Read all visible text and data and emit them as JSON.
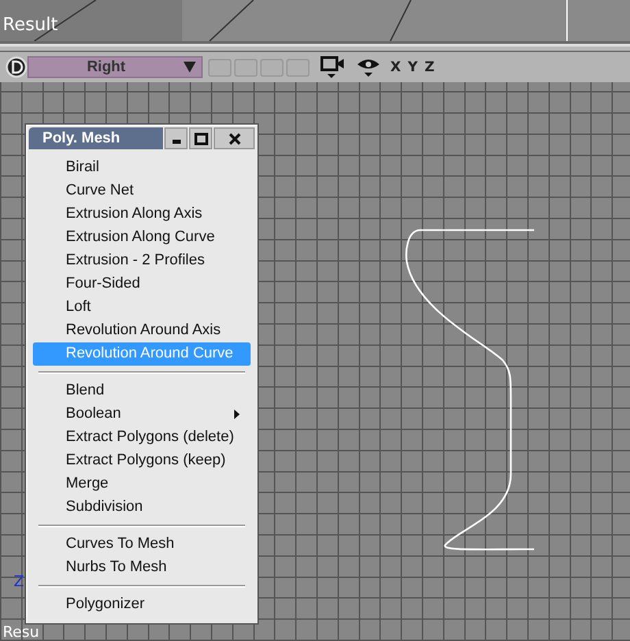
{
  "top_viewport": {
    "label": "Result"
  },
  "toolbar": {
    "view": {
      "value": "Right"
    },
    "axes": [
      "X",
      "Y",
      "Z"
    ]
  },
  "viewport": {
    "axis_label": "Z",
    "bottom_label": "Resu"
  },
  "menu": {
    "title": "Poly. Mesh",
    "groups": [
      [
        {
          "text": "Birail",
          "selected": false,
          "has_submenu": false
        },
        {
          "text": "Curve Net",
          "selected": false,
          "has_submenu": false
        },
        {
          "text": "Extrusion Along Axis",
          "selected": false,
          "has_submenu": false
        },
        {
          "text": "Extrusion Along Curve",
          "selected": false,
          "has_submenu": false
        },
        {
          "text": "Extrusion - 2 Profiles",
          "selected": false,
          "has_submenu": false
        },
        {
          "text": "Four-Sided",
          "selected": false,
          "has_submenu": false
        },
        {
          "text": "Loft",
          "selected": false,
          "has_submenu": false
        },
        {
          "text": "Revolution Around Axis",
          "selected": false,
          "has_submenu": false
        },
        {
          "text": "Revolution Around Curve",
          "selected": true,
          "has_submenu": false
        }
      ],
      [
        {
          "text": "Blend",
          "selected": false,
          "has_submenu": false
        },
        {
          "text": "Boolean",
          "selected": false,
          "has_submenu": true
        },
        {
          "text": "Extract Polygons (delete)",
          "selected": false,
          "has_submenu": false
        },
        {
          "text": "Extract Polygons (keep)",
          "selected": false,
          "has_submenu": false
        },
        {
          "text": "Merge",
          "selected": false,
          "has_submenu": false
        },
        {
          "text": "Subdivision",
          "selected": false,
          "has_submenu": false
        }
      ],
      [
        {
          "text": "Curves To Mesh",
          "selected": false,
          "has_submenu": false
        },
        {
          "text": "Nurbs To Mesh",
          "selected": false,
          "has_submenu": false
        }
      ],
      [
        {
          "text": "Polygonizer",
          "selected": false,
          "has_submenu": false
        }
      ]
    ]
  }
}
